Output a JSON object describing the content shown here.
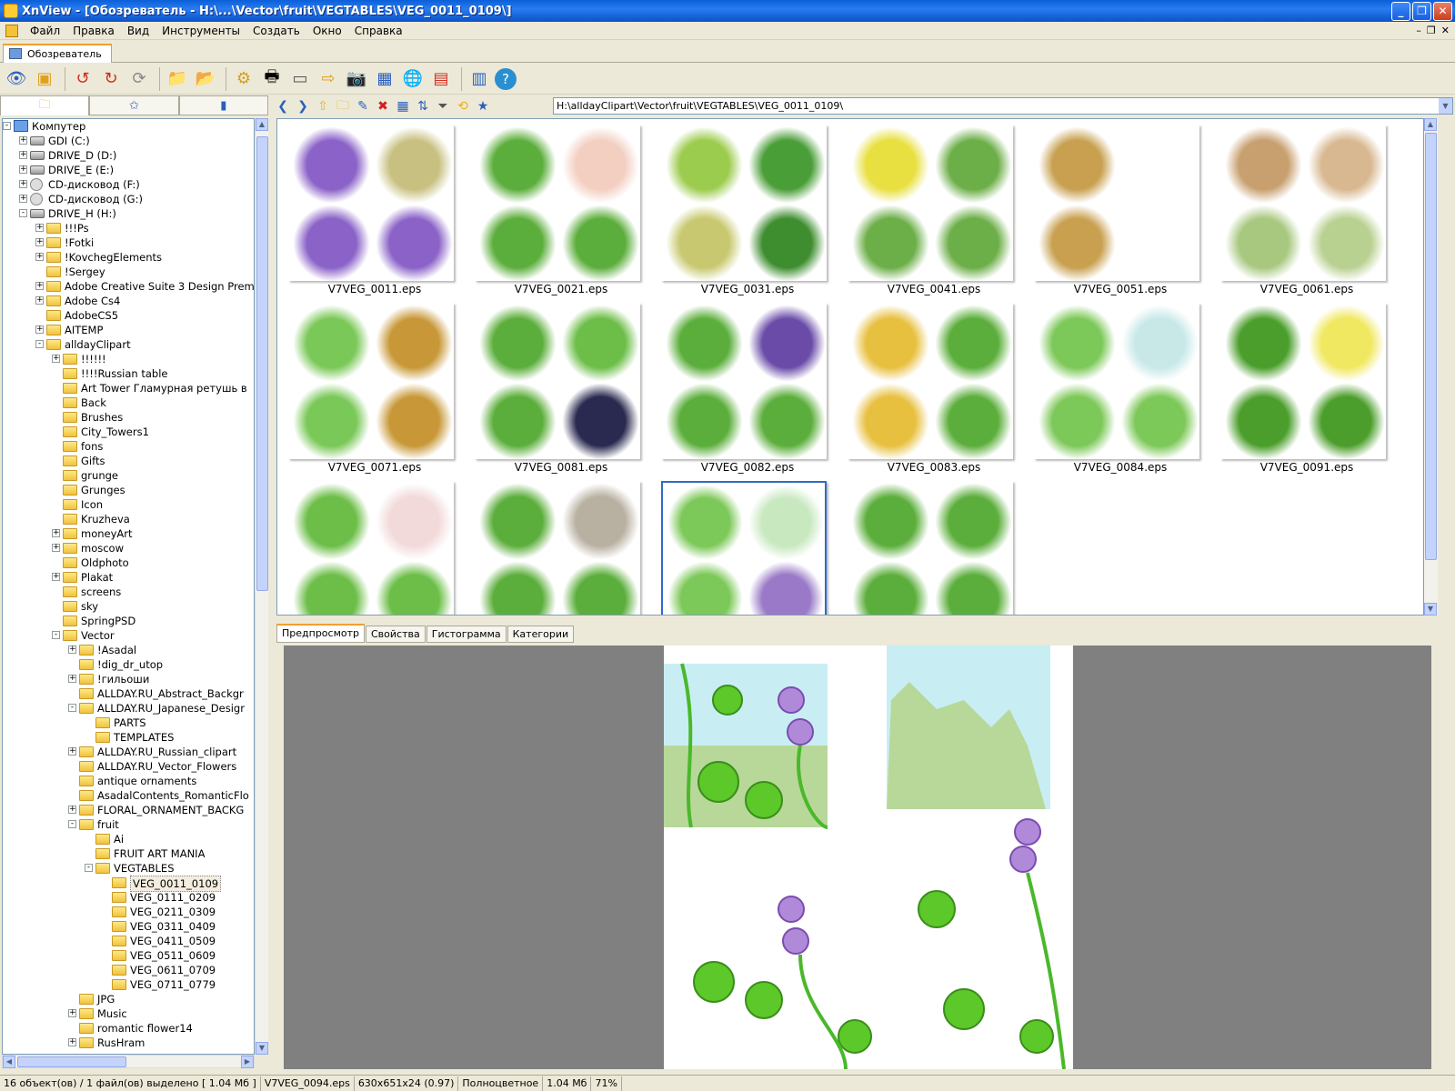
{
  "window": {
    "title": "XnView - [Обозреватель - H:\\...\\Vector\\fruit\\VEGTABLES\\VEG_0011_0109\\]"
  },
  "menu": [
    "Файл",
    "Правка",
    "Вид",
    "Инструменты",
    "Создать",
    "Окно",
    "Справка"
  ],
  "doc_tab": "Обозреватель",
  "address": "H:\\alldayClipart\\Vector\\fruit\\VEGTABLES\\VEG_0011_0109\\",
  "tree": [
    {
      "label": "Компутер",
      "indent": 0,
      "exp": "-",
      "icon": "pc"
    },
    {
      "label": "GDI (C:)",
      "indent": 1,
      "exp": "+",
      "icon": "drv"
    },
    {
      "label": "DRIVE_D (D:)",
      "indent": 1,
      "exp": "+",
      "icon": "drv"
    },
    {
      "label": "DRIVE_E (E:)",
      "indent": 1,
      "exp": "+",
      "icon": "drv"
    },
    {
      "label": "CD-дисковод (F:)",
      "indent": 1,
      "exp": "+",
      "icon": "cdr"
    },
    {
      "label": "CD-дисковод (G:)",
      "indent": 1,
      "exp": "+",
      "icon": "cdr"
    },
    {
      "label": "DRIVE_H (H:)",
      "indent": 1,
      "exp": "-",
      "icon": "drv"
    },
    {
      "label": "!!!Ps",
      "indent": 2,
      "exp": "+",
      "icon": "fold"
    },
    {
      "label": "!Fotki",
      "indent": 2,
      "exp": "+",
      "icon": "fold"
    },
    {
      "label": "!KovchegElements",
      "indent": 2,
      "exp": "+",
      "icon": "fold"
    },
    {
      "label": "!Sergey",
      "indent": 2,
      "exp": "",
      "icon": "fold"
    },
    {
      "label": "Adobe Creative Suite 3 Design Prem",
      "indent": 2,
      "exp": "+",
      "icon": "fold"
    },
    {
      "label": "Adobe Cs4",
      "indent": 2,
      "exp": "+",
      "icon": "fold"
    },
    {
      "label": "AdobeCS5",
      "indent": 2,
      "exp": "",
      "icon": "fold"
    },
    {
      "label": "AITEMP",
      "indent": 2,
      "exp": "+",
      "icon": "fold"
    },
    {
      "label": "alldayClipart",
      "indent": 2,
      "exp": "-",
      "icon": "fold"
    },
    {
      "label": "!!!!!!",
      "indent": 3,
      "exp": "+",
      "icon": "fold"
    },
    {
      "label": "!!!!Russian table",
      "indent": 3,
      "exp": "",
      "icon": "fold"
    },
    {
      "label": "Art Tower  Гламурная ретушь в",
      "indent": 3,
      "exp": "",
      "icon": "fold"
    },
    {
      "label": "Back",
      "indent": 3,
      "exp": "",
      "icon": "fold"
    },
    {
      "label": "Brushes",
      "indent": 3,
      "exp": "",
      "icon": "fold"
    },
    {
      "label": "City_Towers1",
      "indent": 3,
      "exp": "",
      "icon": "fold"
    },
    {
      "label": "fons",
      "indent": 3,
      "exp": "",
      "icon": "fold"
    },
    {
      "label": "Gifts",
      "indent": 3,
      "exp": "",
      "icon": "fold"
    },
    {
      "label": "grunge",
      "indent": 3,
      "exp": "",
      "icon": "fold"
    },
    {
      "label": "Grunges",
      "indent": 3,
      "exp": "",
      "icon": "fold"
    },
    {
      "label": "Icon",
      "indent": 3,
      "exp": "",
      "icon": "fold"
    },
    {
      "label": "Kruzheva",
      "indent": 3,
      "exp": "",
      "icon": "fold"
    },
    {
      "label": "moneyArt",
      "indent": 3,
      "exp": "+",
      "icon": "fold"
    },
    {
      "label": "moscow",
      "indent": 3,
      "exp": "+",
      "icon": "fold"
    },
    {
      "label": "Oldphoto",
      "indent": 3,
      "exp": "",
      "icon": "fold"
    },
    {
      "label": "Plakat",
      "indent": 3,
      "exp": "+",
      "icon": "fold"
    },
    {
      "label": "screens",
      "indent": 3,
      "exp": "",
      "icon": "fold"
    },
    {
      "label": "sky",
      "indent": 3,
      "exp": "",
      "icon": "fold"
    },
    {
      "label": "SpringPSD",
      "indent": 3,
      "exp": "",
      "icon": "fold"
    },
    {
      "label": "Vector",
      "indent": 3,
      "exp": "-",
      "icon": "fold"
    },
    {
      "label": "!Asadal",
      "indent": 4,
      "exp": "+",
      "icon": "fold"
    },
    {
      "label": "!dig_dr_utop",
      "indent": 4,
      "exp": "",
      "icon": "fold"
    },
    {
      "label": "!гильоши",
      "indent": 4,
      "exp": "+",
      "icon": "fold"
    },
    {
      "label": "ALLDAY.RU_Abstract_Backgr",
      "indent": 4,
      "exp": "",
      "icon": "fold"
    },
    {
      "label": "ALLDAY.RU_Japanese_Desigr",
      "indent": 4,
      "exp": "-",
      "icon": "fold"
    },
    {
      "label": "PARTS",
      "indent": 5,
      "exp": "",
      "icon": "fold"
    },
    {
      "label": "TEMPLATES",
      "indent": 5,
      "exp": "",
      "icon": "fold"
    },
    {
      "label": "ALLDAY.RU_Russian_clipart",
      "indent": 4,
      "exp": "+",
      "icon": "fold"
    },
    {
      "label": "ALLDAY.RU_Vector_Flowers",
      "indent": 4,
      "exp": "",
      "icon": "fold"
    },
    {
      "label": "antique ornaments",
      "indent": 4,
      "exp": "",
      "icon": "fold"
    },
    {
      "label": "AsadalContents_RomanticFlo",
      "indent": 4,
      "exp": "",
      "icon": "fold"
    },
    {
      "label": "FLORAL_ORNAMENT_BACKG",
      "indent": 4,
      "exp": "+",
      "icon": "fold"
    },
    {
      "label": "fruit",
      "indent": 4,
      "exp": "-",
      "icon": "fold"
    },
    {
      "label": "Ai",
      "indent": 5,
      "exp": "",
      "icon": "fold"
    },
    {
      "label": "FRUIT ART MANIA",
      "indent": 5,
      "exp": "",
      "icon": "fold"
    },
    {
      "label": "VEGTABLES",
      "indent": 5,
      "exp": "-",
      "icon": "fold"
    },
    {
      "label": "VEG_0011_0109",
      "indent": 6,
      "exp": "",
      "icon": "fold",
      "selected": true
    },
    {
      "label": "VEG_0111_0209",
      "indent": 6,
      "exp": "",
      "icon": "fold"
    },
    {
      "label": "VEG_0211_0309",
      "indent": 6,
      "exp": "",
      "icon": "fold"
    },
    {
      "label": "VEG_0311_0409",
      "indent": 6,
      "exp": "",
      "icon": "fold"
    },
    {
      "label": "VEG_0411_0509",
      "indent": 6,
      "exp": "",
      "icon": "fold"
    },
    {
      "label": "VEG_0511_0609",
      "indent": 6,
      "exp": "",
      "icon": "fold"
    },
    {
      "label": "VEG_0611_0709",
      "indent": 6,
      "exp": "",
      "icon": "fold"
    },
    {
      "label": "VEG_0711_0779",
      "indent": 6,
      "exp": "",
      "icon": "fold"
    },
    {
      "label": "JPG",
      "indent": 4,
      "exp": "",
      "icon": "fold"
    },
    {
      "label": "Music",
      "indent": 4,
      "exp": "+",
      "icon": "fold"
    },
    {
      "label": "romantic flower14",
      "indent": 4,
      "exp": "",
      "icon": "fold"
    },
    {
      "label": "RusHram",
      "indent": 4,
      "exp": "+",
      "icon": "fold"
    }
  ],
  "thumbnails": [
    {
      "label": "V7VEG_0011.eps",
      "colors": [
        "#8a62c8",
        "#c8c080",
        "#8a62c8",
        "#8a62c8"
      ]
    },
    {
      "label": "V7VEG_0021.eps",
      "colors": [
        "#5cae3c",
        "#f3cfc2",
        "#5cae3c",
        "#5cae3c"
      ]
    },
    {
      "label": "V7VEG_0031.eps",
      "colors": [
        "#9ccc4e",
        "#4a9e38",
        "#c8c870",
        "#3e8e30"
      ]
    },
    {
      "label": "V7VEG_0041.eps",
      "colors": [
        "#e8e040",
        "#6cae48",
        "#6cae48",
        "#6cae48"
      ]
    },
    {
      "label": "V7VEG_0051.eps",
      "colors": [
        "#c8a050",
        "#ffffff",
        "#c8a050",
        "#ffffff"
      ]
    },
    {
      "label": "V7VEG_0061.eps",
      "colors": [
        "#c8a070",
        "#d8b890",
        "#a8c880",
        "#b8d090"
      ]
    },
    {
      "label": "V7VEG_0071.eps",
      "colors": [
        "#7ac858",
        "#c89838",
        "#7ac858",
        "#c89838"
      ]
    },
    {
      "label": "V7VEG_0081.eps",
      "colors": [
        "#5cae3c",
        "#6cbe48",
        "#5cae3c",
        "#2a2a50"
      ]
    },
    {
      "label": "V7VEG_0082.eps",
      "colors": [
        "#5cae3c",
        "#6a4ca8",
        "#5cae3c",
        "#5cae3c"
      ]
    },
    {
      "label": "V7VEG_0083.eps",
      "colors": [
        "#e8c040",
        "#5cae3c",
        "#e8c040",
        "#5cae3c"
      ]
    },
    {
      "label": "V7VEG_0084.eps",
      "colors": [
        "#7cc858",
        "#c8e8e8",
        "#7cc858",
        "#7cc858"
      ]
    },
    {
      "label": "V7VEG_0091.eps",
      "colors": [
        "#4c9e2c",
        "#f0e860",
        "#4c9e2c",
        "#4c9e2c"
      ]
    },
    {
      "label": "",
      "colors": [
        "#6cbe48",
        "#f3dada",
        "#6cbe48",
        "#6cbe48"
      ]
    },
    {
      "label": "",
      "colors": [
        "#5cae3c",
        "#b8b0a0",
        "#5cae3c",
        "#5cae3c"
      ]
    },
    {
      "label": "",
      "colors": [
        "#7cc858",
        "#c8e8c0",
        "#7cc858",
        "#9a7ac8"
      ],
      "selected": true
    },
    {
      "label": "",
      "colors": [
        "#5cae3c",
        "#5cae3c",
        "#5cae3c",
        "#5cae3c"
      ]
    }
  ],
  "preview_tabs": [
    "Предпросмотр",
    "Свойства",
    "Гистограмма",
    "Категории"
  ],
  "status": {
    "objects": "16 объект(ов) / 1 файл(ов) выделено  [ 1.04 Мб ]",
    "file": "V7VEG_0094.eps",
    "dims": "630x651x24 (0.97)",
    "mode": "Полноцветное",
    "size": "1.04 Мб",
    "zoom": "71%"
  }
}
